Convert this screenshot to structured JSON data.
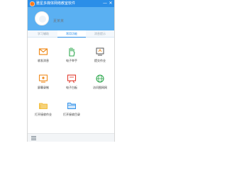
{
  "window": {
    "title": "雅星多媒体网络教室软件",
    "minimize_glyph": "—",
    "close_glyph": "✕"
  },
  "user": {
    "name": "夏某某"
  },
  "tabs": [
    {
      "label": "学习辅助",
      "active": false
    },
    {
      "label": "常用功能",
      "active": true
    },
    {
      "label": "消息提示",
      "active": false
    }
  ],
  "features": [
    {
      "label": "收发消息",
      "icon": "envelope-icon",
      "color": "#f08c1e"
    },
    {
      "label": "电子举手",
      "icon": "raise-hand-icon",
      "color": "#2fa84f"
    },
    {
      "label": "提交作业",
      "icon": "submit-homework-icon",
      "color": "#555555"
    },
    {
      "label": "屏幕录制",
      "icon": "screen-record-icon",
      "color": "#f08c1e"
    },
    {
      "label": "电子白板",
      "icon": "whiteboard-icon",
      "color": "#e23b2e"
    },
    {
      "label": "访问图网网",
      "icon": "browse-icon",
      "color": "#2fa84f"
    },
    {
      "label": "打开接收作业",
      "icon": "open-folder-icon",
      "color": "#f0b41e"
    },
    {
      "label": "打开接收目录",
      "icon": "folder-icon",
      "color": "#2b8ee8"
    }
  ],
  "colors": {
    "titlebar": "#2b8ee8",
    "header": "#5ab0f2",
    "active_tab": "#2b8ee8"
  }
}
